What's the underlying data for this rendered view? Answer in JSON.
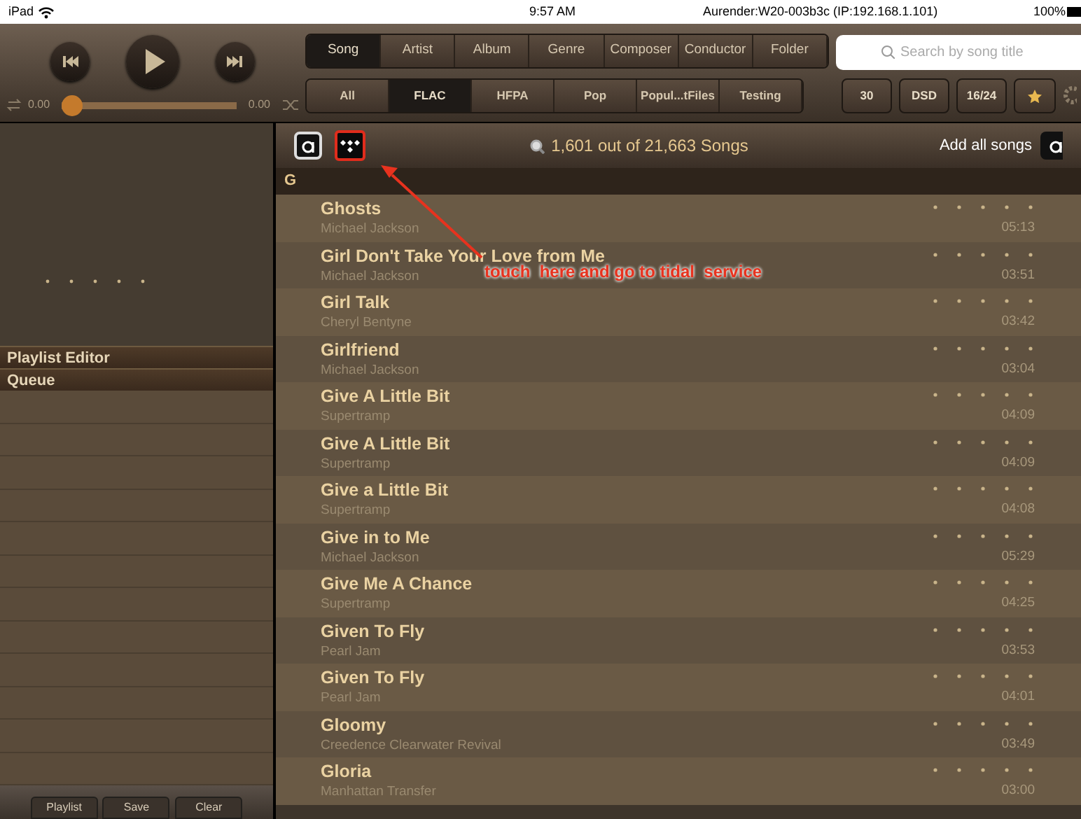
{
  "status_bar": {
    "device": "iPad",
    "time": "9:57 AM",
    "connection": "Aurender:W20-003b3c (IP:192.168.1.101)",
    "battery": "100%"
  },
  "player": {
    "elapsed": "0.00",
    "total": "0.00",
    "level": 0
  },
  "tabs": [
    {
      "label": "Song",
      "selected": true
    },
    {
      "label": "Artist",
      "selected": false
    },
    {
      "label": "Album",
      "selected": false
    },
    {
      "label": "Genre",
      "selected": false
    },
    {
      "label": "Composer",
      "selected": false
    },
    {
      "label": "Conductor",
      "selected": false
    },
    {
      "label": "Folder",
      "selected": false
    }
  ],
  "search": {
    "placeholder": "Search by song title"
  },
  "filters": [
    {
      "label": "All",
      "selected": false
    },
    {
      "label": "FLAC",
      "selected": true
    },
    {
      "label": "HFPA",
      "selected": false
    },
    {
      "label": "Pop",
      "selected": false
    },
    {
      "label": "Popul...tFiles",
      "selected": false
    },
    {
      "label": "Testing",
      "selected": false
    }
  ],
  "quick_buttons": [
    "30",
    "DSD",
    "16/24"
  ],
  "sidebar": {
    "items": [
      {
        "label": "Playlist Editor"
      },
      {
        "label": "Queue"
      }
    ],
    "buttons": [
      "Playlist",
      "Save",
      "Clear"
    ]
  },
  "list_header": {
    "count": "1,601 out of 21,663 Songs",
    "add_all": "Add all songs"
  },
  "section": "G",
  "songs": [
    {
      "title": "Ghosts",
      "artist": "Michael Jackson",
      "duration": "05:13"
    },
    {
      "title": "Girl Don't Take Your Love from Me",
      "artist": "Michael Jackson",
      "duration": "03:51"
    },
    {
      "title": "Girl Talk",
      "artist": "Cheryl Bentyne",
      "duration": "03:42"
    },
    {
      "title": "Girlfriend",
      "artist": "Michael Jackson",
      "duration": "03:04"
    },
    {
      "title": "Give A Little Bit",
      "artist": "Supertramp",
      "duration": "04:09"
    },
    {
      "title": "Give A Little Bit",
      "artist": "Supertramp",
      "duration": "04:09"
    },
    {
      "title": "Give a Little Bit",
      "artist": "Supertramp",
      "duration": "04:08"
    },
    {
      "title": "Give in to Me",
      "artist": "Michael Jackson",
      "duration": "05:29"
    },
    {
      "title": "Give Me A Chance",
      "artist": "Supertramp",
      "duration": "04:25"
    },
    {
      "title": "Given To Fly",
      "artist": "Pearl Jam",
      "duration": "03:53"
    },
    {
      "title": "Given To Fly",
      "artist": "Pearl Jam",
      "duration": "04:01"
    },
    {
      "title": "Gloomy",
      "artist": "Creedence Clearwater Revival",
      "duration": "03:49"
    },
    {
      "title": "Gloria",
      "artist": "Manhattan Transfer",
      "duration": "03:00"
    }
  ],
  "annotation": {
    "text": "touch  here and go to tidal  service"
  }
}
